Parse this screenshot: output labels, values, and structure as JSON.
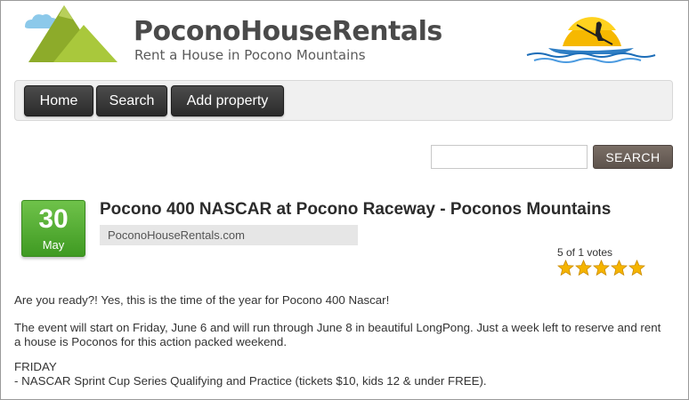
{
  "header": {
    "site_title": "PoconoHouseRentals",
    "tagline": "Rent a House in Pocono Mountains"
  },
  "nav": {
    "home_label": "Home",
    "search_label": "Search",
    "add_property_label": "Add property"
  },
  "search": {
    "value": "",
    "placeholder": "",
    "button_label": "SEARCH"
  },
  "article": {
    "date_day": "30",
    "date_month": "May",
    "title": "Pocono 400 NASCAR at Pocono Raceway - Poconos Mountains",
    "author": "PoconoHouseRentals.com",
    "rating_text": "5 of 1 votes",
    "rating_value": 5,
    "rating_max": 5,
    "paragraph1": "Are you ready?! Yes, this is the time of the year for Pocono 400 Nascar!",
    "paragraph2": "The event will start on Friday, June 6 and will run through June 8 in beautiful LongPong. Just a week left to reserve and rent a house is Poconos for this action packed weekend.",
    "paragraph3_heading": "FRIDAY",
    "paragraph3_item": "- NASCAR Sprint Cup Series Qualifying and Practice (tickets $10, kids 12 & under FREE)."
  },
  "colors": {
    "nav_button": "#333333",
    "date_badge": "#4fae2c",
    "search_button": "#6b6058",
    "star": "#f5b400"
  },
  "icons": {
    "logo_left": "mountains-cloud-logo",
    "logo_right": "kayak-sunset-logo",
    "rating": "star-icon"
  }
}
